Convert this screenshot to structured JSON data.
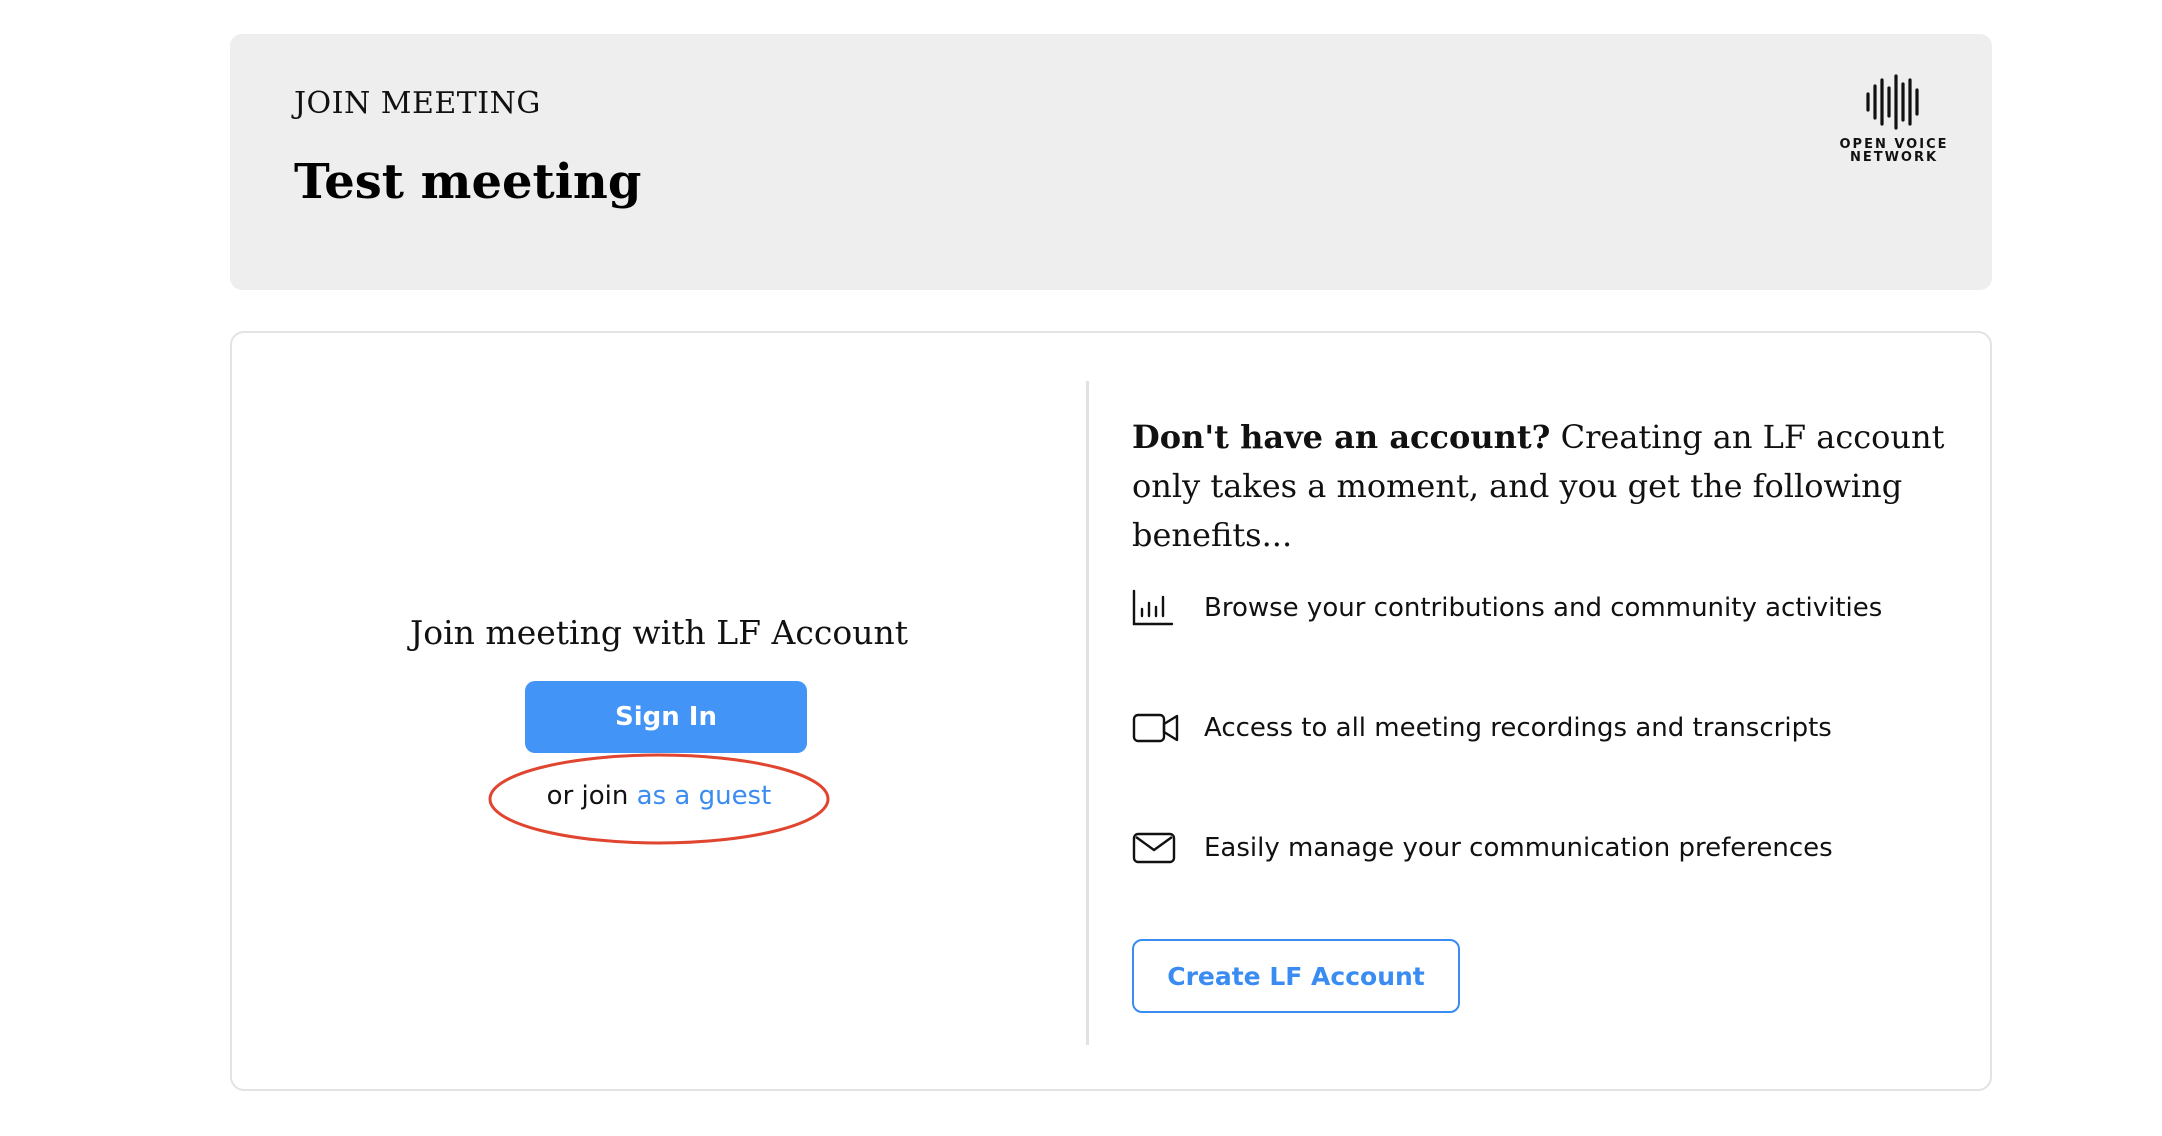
{
  "header": {
    "eyebrow": "JOIN MEETING",
    "meeting_title": "Test meeting",
    "logo": {
      "icon": "soundwave-logo-icon",
      "line1": "OPEN VOICE",
      "line2": "NETWORK"
    }
  },
  "left_panel": {
    "heading": "Join meeting with LF Account",
    "sign_in_label": "Sign In",
    "guest_prefix": "or join",
    "guest_link": "as a guest",
    "highlight_color": "#e0452f"
  },
  "right_panel": {
    "intro_bold": "Don't have an account?",
    "intro_rest": " Creating an LF account only takes a moment, and you get the following benefits...",
    "benefits": [
      {
        "icon": "bar-chart-icon",
        "label": "Browse your contributions and community activities"
      },
      {
        "icon": "video-camera-icon",
        "label": "Access to all meeting recordings and transcripts"
      },
      {
        "icon": "envelope-icon",
        "label": "Easily manage your communication preferences"
      }
    ],
    "create_account_label": "Create LF Account"
  },
  "colors": {
    "accent": "#4294f7",
    "link": "#3a8cf2",
    "header_bg": "#eeeeee",
    "border": "#e3e3e3"
  }
}
